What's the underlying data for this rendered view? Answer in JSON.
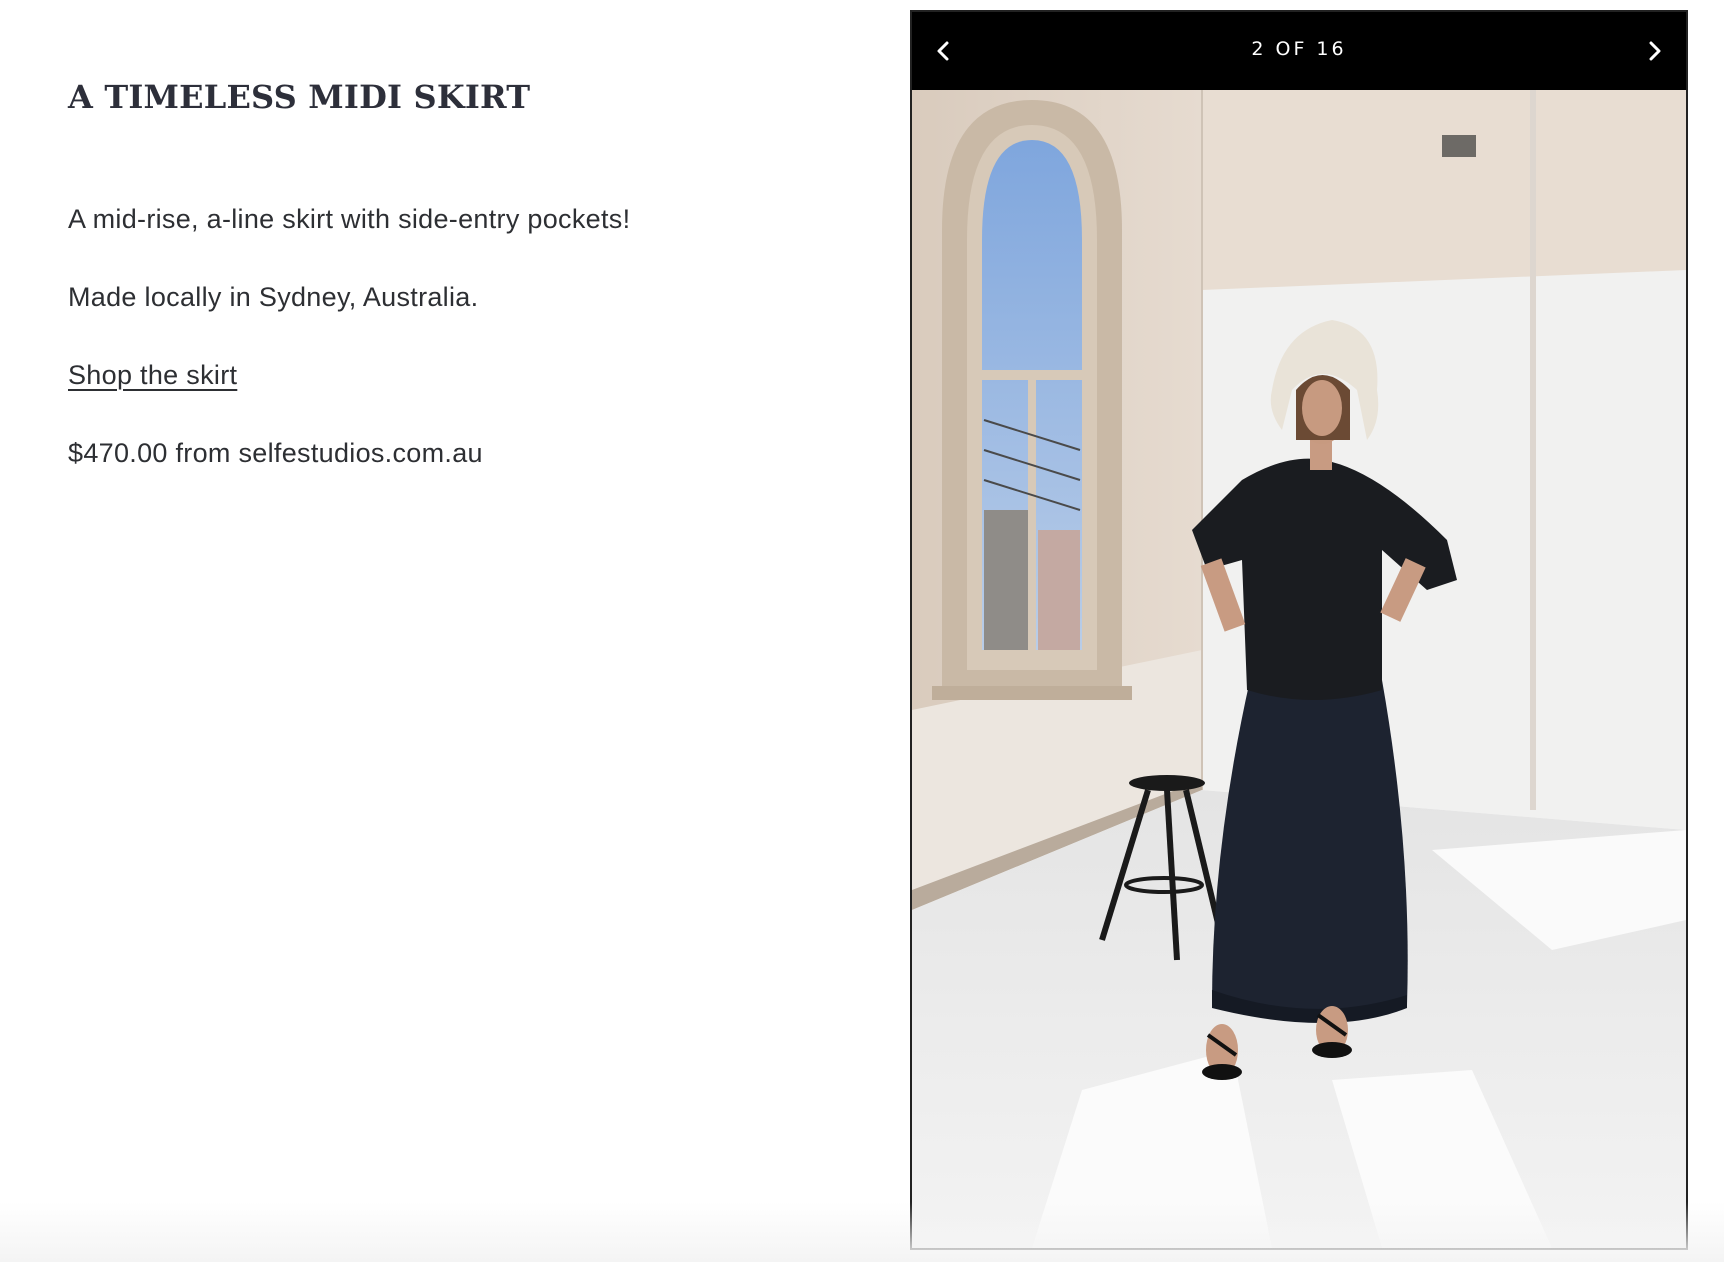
{
  "article": {
    "headline": "A TIMELESS MIDI SKIRT",
    "description": "A mid-rise, a-line skirt with side-entry pockets!",
    "origin": "Made locally in Sydney, Australia.",
    "shop_link": "Shop the skirt",
    "price_line": "$470.00 from selfestudios.com.au"
  },
  "gallery": {
    "counter": "2 OF 16",
    "prev_icon": "chevron-left-icon",
    "next_icon": "chevron-right-icon"
  },
  "colors": {
    "text": "#2d2f33",
    "bar": "#000000"
  }
}
